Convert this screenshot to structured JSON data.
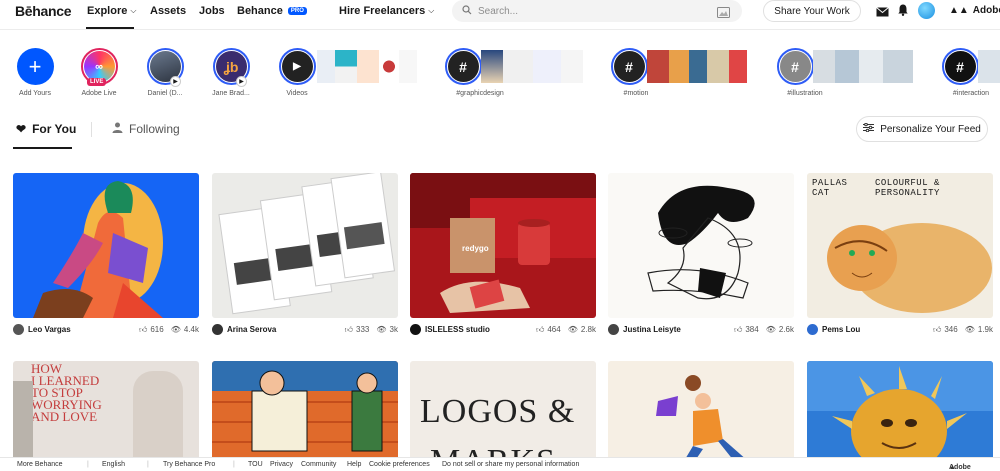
{
  "nav": {
    "logo": "Bēhance",
    "explore": "Explore",
    "assets": "Assets",
    "jobs": "Jobs",
    "behance_pro": "Behance",
    "pro_badge": "PRO",
    "hire": "Hire Freelancers",
    "search_placeholder": "Search...",
    "share": "Share Your Work",
    "adobe": "Adobe"
  },
  "stories": [
    {
      "label": "Add Yours",
      "icon": "plus-icon"
    },
    {
      "label": "Adobe Live",
      "badge": "LIVE"
    },
    {
      "label": "Daniel (D..."
    },
    {
      "label": "Jane Brad..."
    },
    {
      "label": "Videos",
      "icon": "play-icon"
    },
    {
      "label": "#graphicdesign",
      "icon": "hash-icon"
    },
    {
      "label": "#motion",
      "icon": "hash-icon"
    },
    {
      "label": "#illustration",
      "icon": "hash-icon"
    },
    {
      "label": "#interaction",
      "icon": "hash-icon"
    }
  ],
  "tabs": {
    "for_you": "For You",
    "following": "Following",
    "personalize": "Personalize Your Feed"
  },
  "projects": [
    {
      "author": "Leo Vargas",
      "likes": "616",
      "views": "4.4k"
    },
    {
      "author": "Arina Serova",
      "likes": "333",
      "views": "3k"
    },
    {
      "author": "ISLELESS studio",
      "likes": "464",
      "views": "2.8k"
    },
    {
      "author": "Justina Leisyte",
      "likes": "384",
      "views": "2.6k"
    },
    {
      "author": "Pems Lou",
      "likes": "346",
      "views": "1.9k"
    }
  ],
  "thumb_text": {
    "pallas_left": "PALLAS\nCAT",
    "pallas_right": "COLOURFUL &\nPERSONALITY",
    "how_learned": "HOW\nI LEARNED\nTO STOP\nWORRYING\nAND LOVE",
    "logos": "LOGOS &",
    "marks": "MARKS",
    "redygo": "redygo"
  },
  "footer": {
    "more": "More Behance",
    "english": "English",
    "try_pro": "Try Behance Pro",
    "tou": "TOU",
    "privacy": "Privacy",
    "community": "Community",
    "help": "Help",
    "cookie": "Cookie preferences",
    "donotsell": "Do not sell or share my personal information",
    "adobe": "Adobe"
  },
  "colors": {
    "accent": "#0057ff",
    "story_ring": "#2e5cf6",
    "live": "#e0245e"
  }
}
